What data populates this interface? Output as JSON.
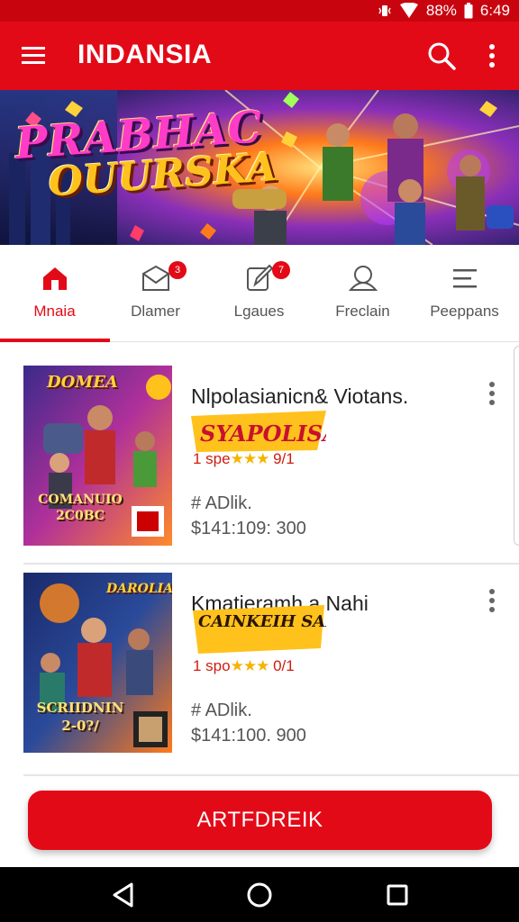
{
  "status": {
    "battery": "88%",
    "time": "6:49"
  },
  "app": {
    "title": "INDANSIA"
  },
  "banner": {
    "line1": "PRABHAC",
    "line2": "OUURSKA"
  },
  "tabs": [
    {
      "label": "Mnaia",
      "icon": "home-icon",
      "badge": ""
    },
    {
      "label": "Dlamer",
      "icon": "mail-icon",
      "badge": "3"
    },
    {
      "label": "Lgaues",
      "icon": "edit-icon",
      "badge": "7"
    },
    {
      "label": "Freclain",
      "icon": "user-icon",
      "badge": ""
    },
    {
      "label": "Peeppans",
      "icon": "list-icon",
      "badge": ""
    }
  ],
  "items": [
    {
      "title": "Nlpolasianicn& Viotans.",
      "logo_text": "SYAPOLISA!",
      "thumb_top": "DOMEA",
      "thumb_bottom": "COMANUIO 2C0BC",
      "rating_prefix": "1 spe",
      "rating_suffix": "9/1",
      "tag": "# ADlik.",
      "price": "$141:109: 300"
    },
    {
      "title": "Kmatieramh a Nahi",
      "logo_text": "CAINKEIH SARSRPAN",
      "thumb_top": "DAROLIA",
      "thumb_bottom": "SCRIIDNIN 2-0?/",
      "rating_prefix": "1 spo",
      "rating_suffix": "0/1",
      "tag": "# ADlik.",
      "price": "$141:100. 900"
    }
  ],
  "cta": {
    "label": "ARTFDREIK"
  },
  "colors": {
    "primary": "#e30a17",
    "star": "#f4b400"
  }
}
